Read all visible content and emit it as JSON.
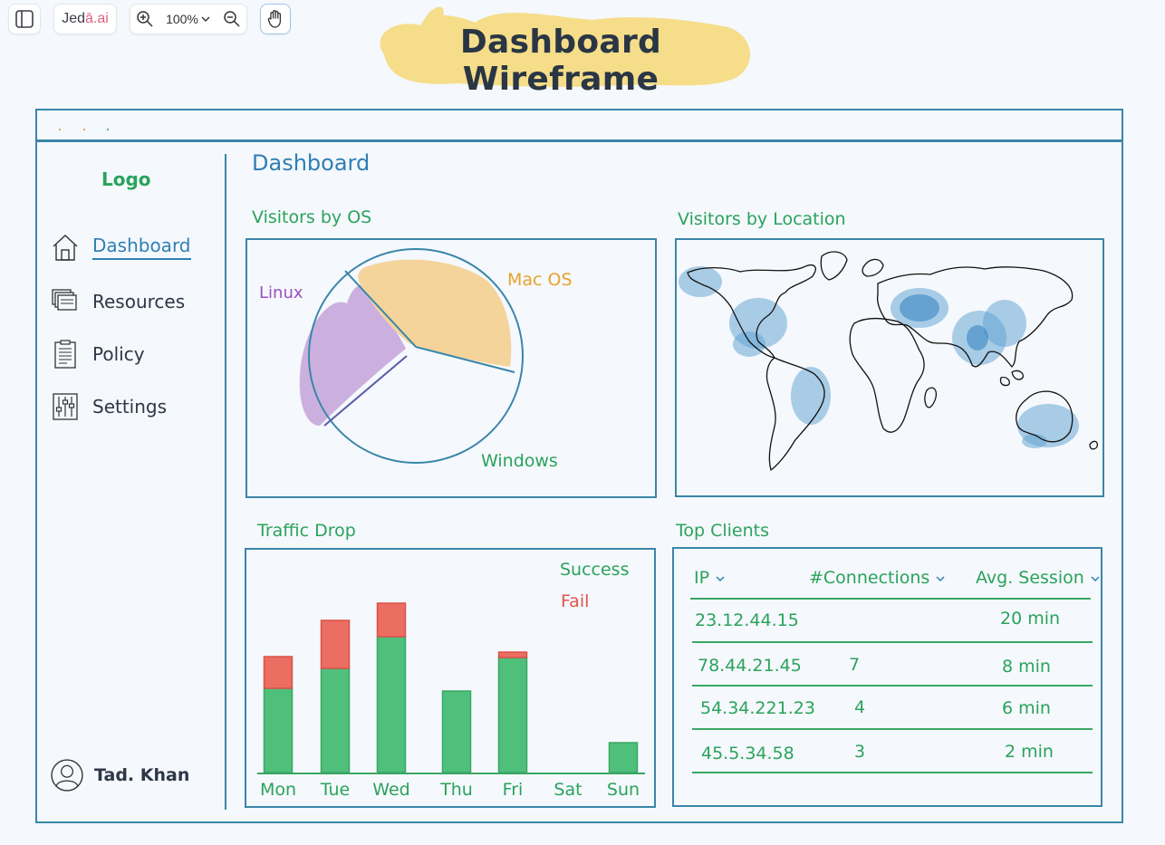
{
  "toolbar": {
    "brand_prefix": "Jed",
    "brand_accent": "ā.ai",
    "zoom": "100%"
  },
  "title": "Dashboard Wireframe",
  "sidebar": {
    "logo": "Logo",
    "items": [
      {
        "label": "Dashboard",
        "icon": "home-icon",
        "active": true
      },
      {
        "label": "Resources",
        "icon": "resources-icon",
        "active": false
      },
      {
        "label": "Policy",
        "icon": "policy-icon",
        "active": false
      },
      {
        "label": "Settings",
        "icon": "settings-icon",
        "active": false
      }
    ],
    "user": "Tad. Khan"
  },
  "main": {
    "heading": "Dashboard",
    "os_panel": {
      "title": "Visitors by OS",
      "labels": {
        "linux": "Linux",
        "mac": "Mac OS",
        "windows": "Windows"
      }
    },
    "location_panel": {
      "title": "Visitors by Location"
    },
    "traffic_panel": {
      "title": "Traffic Drop",
      "legend_success": "Success",
      "legend_fail": "Fail"
    },
    "clients_panel": {
      "title": "Top Clients",
      "headers": {
        "ip": "IP",
        "connections": "#Connections",
        "session": "Avg. Session"
      },
      "rows": [
        {
          "ip": "23.12.44.15",
          "connections": "",
          "session": "20 min"
        },
        {
          "ip": "78.44.21.45",
          "connections": "7",
          "session": "8 min"
        },
        {
          "ip": "54.34.221.23",
          "connections": "4",
          "session": "6 min"
        },
        {
          "ip": "45.5.34.58",
          "connections": "3",
          "session": "2 min"
        }
      ]
    }
  },
  "chart_data": {
    "type": "bar",
    "categories": [
      "Mon",
      "Tue",
      "Wed",
      "Thu",
      "Fri",
      "Sat",
      "Sun"
    ],
    "series": [
      {
        "name": "Success",
        "values": [
          93,
          115,
          150,
          90,
          127,
          0,
          33
        ]
      },
      {
        "name": "Fail",
        "values": [
          35,
          53,
          37,
          0,
          6,
          0,
          0
        ]
      }
    ],
    "ylim": [
      0,
      200
    ],
    "colors": {
      "success": "#4fbf7c",
      "fail": "#ec6d62"
    }
  },
  "colors": {
    "accent": "#3a86a8",
    "green": "#2aa35c",
    "linux": "#9b4fc2",
    "mac": "#e8a22f",
    "title_highlight": "#f5dd8a"
  }
}
